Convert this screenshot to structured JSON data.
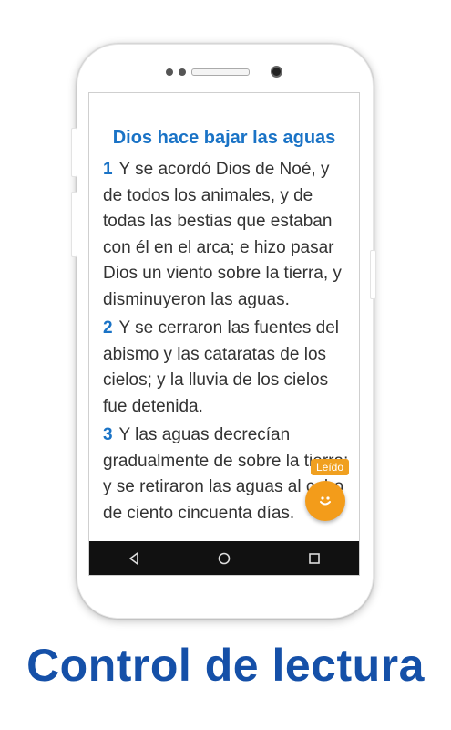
{
  "chapter_title": "Dios hace bajar las aguas",
  "verses": [
    {
      "num": "1",
      "text": "Y se acordó Dios de Noé, y de todos los animales, y de todas las bestias que estaban con él en el arca; e hizo pasar Dios un viento sobre la tierra, y disminuyeron las aguas."
    },
    {
      "num": "2",
      "text": "Y se cerraron las fuentes del abismo y las cataratas de los cielos; y la lluvia de los cielos fue detenida."
    },
    {
      "num": "3",
      "text": "Y las aguas decrecían gradualmente de sobre la tierra; y se retiraron las aguas al cabo de ciento cincuenta días."
    }
  ],
  "read_button": {
    "label": "Leído",
    "icon": "smiley-icon",
    "color": "#f39c1a"
  },
  "nav": {
    "back_icon": "back-triangle-icon",
    "home_icon": "home-circle-icon",
    "recents_icon": "recents-square-icon"
  },
  "caption": "Control de lectura",
  "colors": {
    "accent_blue": "#1a73c6",
    "caption_blue": "#1550a8",
    "fab_orange": "#f39c1a"
  }
}
